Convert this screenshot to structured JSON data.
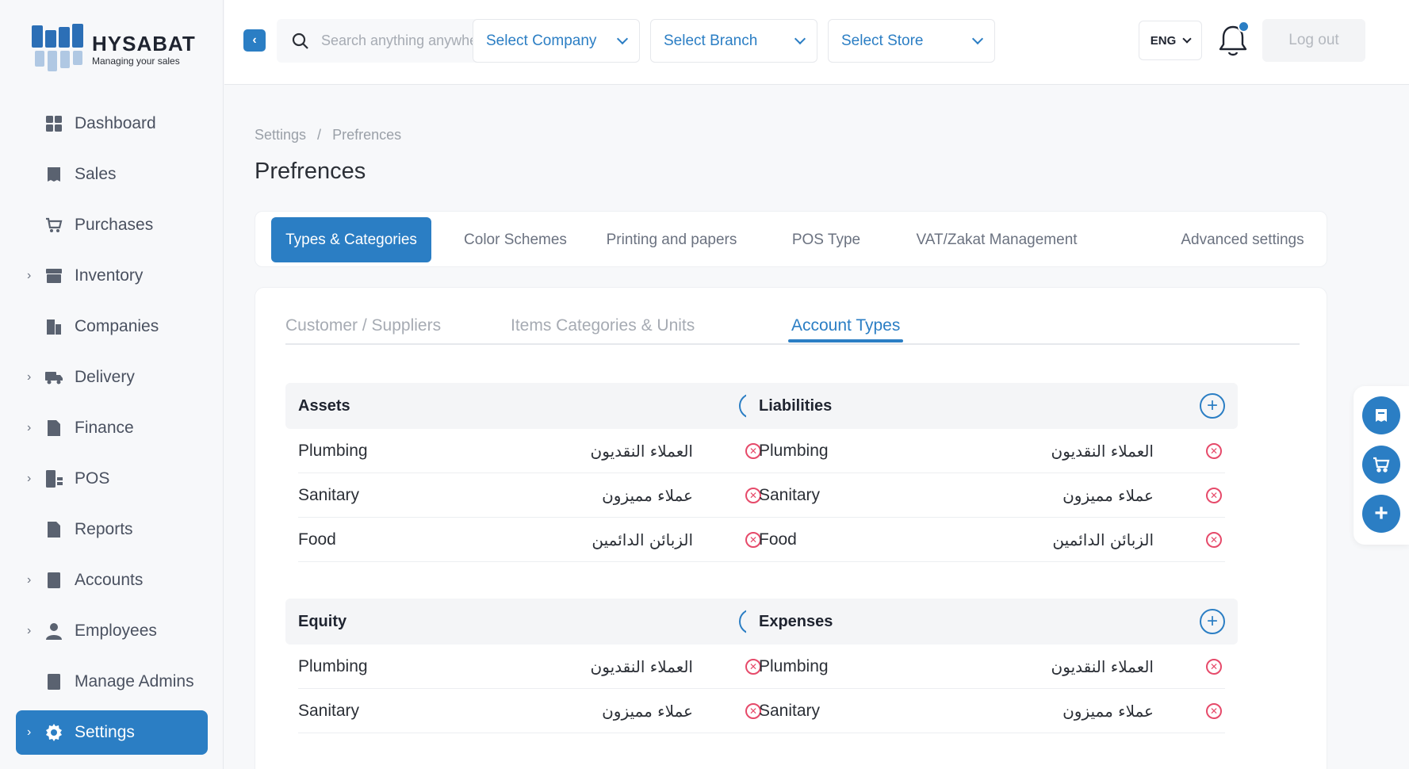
{
  "brand": {
    "name": "HYSABAT",
    "tagline": "Managing your sales"
  },
  "sidebar": {
    "items": [
      {
        "label": "Dashboard",
        "icon": "dashboard-icon",
        "expandable": false,
        "active": false
      },
      {
        "label": "Sales",
        "icon": "sales-icon",
        "expandable": false,
        "active": false
      },
      {
        "label": "Purchases",
        "icon": "purchases-icon",
        "expandable": false,
        "active": false
      },
      {
        "label": "Inventory",
        "icon": "inventory-icon",
        "expandable": true,
        "active": false
      },
      {
        "label": "Companies",
        "icon": "companies-icon",
        "expandable": false,
        "active": false
      },
      {
        "label": "Delivery",
        "icon": "delivery-icon",
        "expandable": true,
        "active": false
      },
      {
        "label": "Finance",
        "icon": "finance-icon",
        "expandable": true,
        "active": false
      },
      {
        "label": "POS",
        "icon": "pos-icon",
        "expandable": true,
        "active": false
      },
      {
        "label": "Reports",
        "icon": "reports-icon",
        "expandable": false,
        "active": false
      },
      {
        "label": "Accounts",
        "icon": "accounts-icon",
        "expandable": true,
        "active": false
      },
      {
        "label": "Employees",
        "icon": "employees-icon",
        "expandable": true,
        "active": false
      },
      {
        "label": "Manage Admins",
        "icon": "manage-admins-icon",
        "expandable": false,
        "active": false
      },
      {
        "label": "Settings",
        "icon": "gear-icon",
        "expandable": true,
        "active": true
      }
    ]
  },
  "header": {
    "search_placeholder": "Search anything anywhere",
    "select_company": "Select Company",
    "select_branch": "Select Branch",
    "select_store": "Select Store",
    "language": "ENG",
    "logout": "Log out"
  },
  "breadcrumb": {
    "parent": "Settings",
    "separator": "/",
    "current": "Prefrences"
  },
  "page_title": "Prefrences",
  "tabs": [
    {
      "label": "Types & Categories",
      "active": true
    },
    {
      "label": "Color Schemes",
      "active": false
    },
    {
      "label": "Printing and papers",
      "active": false
    },
    {
      "label": "POS Type",
      "active": false
    },
    {
      "label": "VAT/Zakat Management",
      "active": false
    },
    {
      "label": "Advanced settings",
      "active": false
    }
  ],
  "subtabs": [
    {
      "label": "Customer / Suppliers",
      "active": false
    },
    {
      "label": "Items Categories & Units",
      "active": false
    },
    {
      "label": "Account Types",
      "active": true
    }
  ],
  "groups": [
    {
      "title": "Assets",
      "rows": [
        {
          "en": "Plumbing",
          "ar": "العملاء النقديون"
        },
        {
          "en": "Sanitary",
          "ar": "عملاء مميزون"
        },
        {
          "en": "Food",
          "ar": "الزبائن الدائمين"
        }
      ]
    },
    {
      "title": "Liabilities",
      "rows": [
        {
          "en": "Plumbing",
          "ar": "العملاء النقديون"
        },
        {
          "en": "Sanitary",
          "ar": "عملاء مميزون"
        },
        {
          "en": "Food",
          "ar": "الزبائن الدائمين"
        }
      ]
    },
    {
      "title": "Equity",
      "rows": [
        {
          "en": "Plumbing",
          "ar": "العملاء النقديون"
        },
        {
          "en": "Sanitary",
          "ar": "عملاء مميزون"
        }
      ]
    },
    {
      "title": "Expenses",
      "rows": [
        {
          "en": "Plumbing",
          "ar": "العملاء النقديون"
        },
        {
          "en": "Sanitary",
          "ar": "عملاء مميزون"
        }
      ]
    }
  ],
  "colors": {
    "accent": "#2b7ec4",
    "danger": "#e64a6a",
    "muted": "#a6abb3"
  }
}
